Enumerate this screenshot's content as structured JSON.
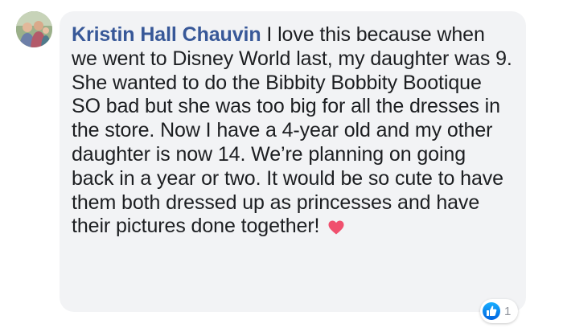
{
  "comment": {
    "author": "Kristin Hall Chauvin",
    "text": " I love this because when we went to Disney World last, my daughter was 9. She wanted to do the Bibbity Bobbity Bootique SO bad but she was too big for all the dresses in the store. Now I have a 4-year old and my other daughter is now 14. We’re planning on going back in a year or two. It would be so cute to have them both dressed up as princesses and have their pictures done together! ",
    "emoji": "heart-icon"
  },
  "reactions": {
    "icon": "like-icon",
    "count": "1"
  },
  "colors": {
    "author": "#385898",
    "bubble": "#f2f3f5",
    "like": "#1877f2",
    "heart": "#f0506e"
  }
}
